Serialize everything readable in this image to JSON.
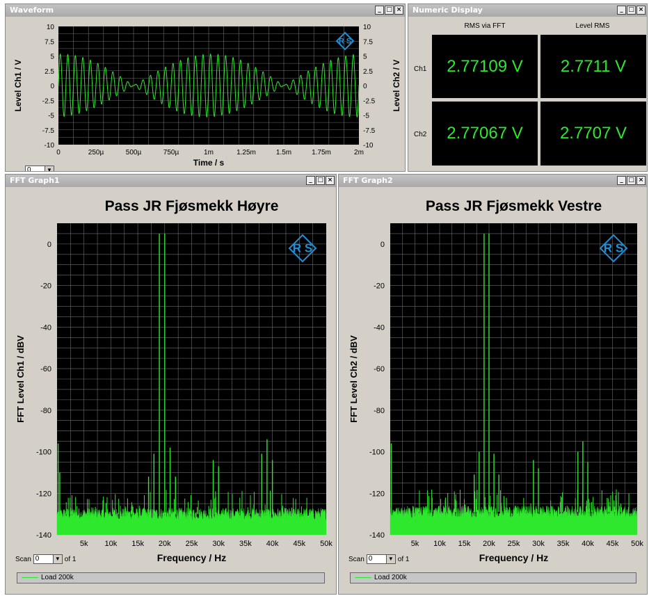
{
  "waveform": {
    "title": "Waveform",
    "ylabel_left": "Level Ch1 / V",
    "ylabel_right": "Level Ch2 / V",
    "xlabel": "Time / s",
    "yticks": [
      "10",
      "7.5",
      "5",
      "2.5",
      "0",
      "-2.5",
      "-5",
      "-7.5",
      "-10"
    ],
    "xticks": [
      "0",
      "250µ",
      "500µ",
      "750µ",
      "1m",
      "1.25m",
      "1.5m",
      "1.75m",
      "2m"
    ],
    "scan_value": "0"
  },
  "numeric": {
    "title": "Numeric Display",
    "col1": "RMS via FFT",
    "col2": "Level RMS",
    "row1": "Ch1",
    "row2": "Ch2",
    "ch1_fft": "2.77109 V",
    "ch1_rms": "2.7711 V",
    "ch2_fft": "2.77067 V",
    "ch2_rms": "2.7707 V"
  },
  "fft1": {
    "window_title": "FFT Graph1",
    "title": "Pass JR Fjøsmekk Høyre",
    "ylabel": "FFT Level Ch1 / dBV",
    "xlabel": "Frequency / Hz",
    "scan_label": "Scan",
    "scan_value": "0",
    "of_label": "of 1",
    "legend": "Load 200k"
  },
  "fft2": {
    "window_title": "FFT Graph2",
    "title": "Pass JR Fjøsmekk Vestre",
    "ylabel": "FFT Level Ch2 / dBV",
    "xlabel": "Frequency / Hz",
    "scan_label": "Scan",
    "scan_value": "0",
    "of_label": "of 1",
    "legend": "Load 200k"
  },
  "fft_axes": {
    "yticks": [
      "0",
      "-20",
      "-40",
      "-60",
      "-80",
      "-100",
      "-120",
      "-140"
    ],
    "xticks": [
      "5k",
      "10k",
      "15k",
      "20k",
      "25k",
      "30k",
      "35k",
      "40k",
      "45k",
      "50k"
    ]
  },
  "colors": {
    "trace": "#2ee82e",
    "plot_bg": "#000000",
    "grid": "#6e6e6e",
    "logo": "#1f8fd6",
    "window_bg": "#d4d0c8"
  },
  "chart_data": [
    {
      "type": "line",
      "xlabel": "Time / s",
      "ylabel": "Level Ch1 / V",
      "ylabel_right": "Level Ch2 / V",
      "xlim": [
        0,
        0.002
      ],
      "ylim": [
        -10,
        10
      ],
      "grid": true,
      "description": "beating 20 kHz sine with envelope peaks ~5.5 V at 0, 1m, 2m and nulls near 500µ and 1.5m"
    },
    {
      "type": "line",
      "title": "Pass JR Fjøsmekk Høyre",
      "xlabel": "Frequency / Hz",
      "ylabel": "FFT Level Ch1 / dBV",
      "xlim": [
        0,
        50000
      ],
      "ylim": [
        -140,
        10
      ],
      "grid": true,
      "noise_floor_dBV": -130,
      "series": [
        {
          "name": "Load 200k",
          "peaks": [
            {
              "x": 19000,
              "y": 5
            },
            {
              "x": 20000,
              "y": 5
            },
            {
              "x": 18000,
              "y": -101
            },
            {
              "x": 21000,
              "y": -98
            },
            {
              "x": 22000,
              "y": -112
            },
            {
              "x": 17000,
              "y": -112
            },
            {
              "x": 29000,
              "y": -104
            },
            {
              "x": 30000,
              "y": -107
            },
            {
              "x": 38000,
              "y": -101
            },
            {
              "x": 39000,
              "y": -94
            },
            {
              "x": 40000,
              "y": -104
            },
            {
              "x": 200,
              "y": -96
            },
            {
              "x": 500,
              "y": -110
            }
          ]
        }
      ]
    },
    {
      "type": "line",
      "title": "Pass JR Fjøsmekk Vestre",
      "xlabel": "Frequency / Hz",
      "ylabel": "FFT Level Ch2 / dBV",
      "xlim": [
        0,
        50000
      ],
      "ylim": [
        -140,
        10
      ],
      "grid": true,
      "noise_floor_dBV": -129,
      "series": [
        {
          "name": "Load 200k",
          "peaks": [
            {
              "x": 19000,
              "y": 5
            },
            {
              "x": 20000,
              "y": 5
            },
            {
              "x": 18000,
              "y": -100
            },
            {
              "x": 21000,
              "y": -101
            },
            {
              "x": 22000,
              "y": -111
            },
            {
              "x": 17000,
              "y": -111
            },
            {
              "x": 29000,
              "y": -104
            },
            {
              "x": 30000,
              "y": -108
            },
            {
              "x": 38000,
              "y": -100
            },
            {
              "x": 39000,
              "y": -95
            },
            {
              "x": 40000,
              "y": -105
            },
            {
              "x": 200,
              "y": -96
            }
          ]
        }
      ]
    }
  ]
}
